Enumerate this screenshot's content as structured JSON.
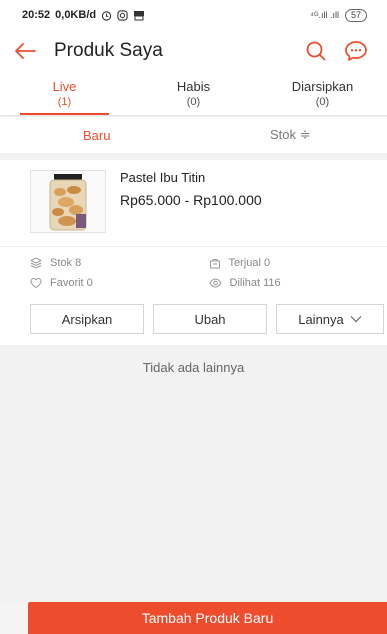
{
  "status_bar": {
    "time": "20:52",
    "speed": "0,0KB/d",
    "signal_text": "⁴ᴳ.ıll .ıll",
    "battery": "57"
  },
  "app_bar": {
    "title": "Produk Saya",
    "icons": [
      "back-arrow-icon",
      "search-icon",
      "chat-icon"
    ]
  },
  "tabs": [
    {
      "label": "Live",
      "count": "(1)",
      "active": true
    },
    {
      "label": "Habis",
      "count": "(0)",
      "active": false
    },
    {
      "label": "Diarsipkan",
      "count": "(0)",
      "active": false
    }
  ],
  "sort": {
    "baru": "Baru",
    "stok": "Stok ≑"
  },
  "product": {
    "name": "Pastel Ibu Titin",
    "price": "Rp65.000 - Rp100.000",
    "stock": "Stok 8",
    "sold": "Terjual 0",
    "favorite": "Favorit 0",
    "views": "Dilihat 116"
  },
  "actions": {
    "archive": "Arsipkan",
    "edit": "Ubah",
    "more": "Lainnya"
  },
  "empty_message": "Tidak ada lainnya",
  "bottom": {
    "add_button": "Tambah Produk Baru"
  },
  "colors": {
    "accent": "#ee4d2d"
  }
}
